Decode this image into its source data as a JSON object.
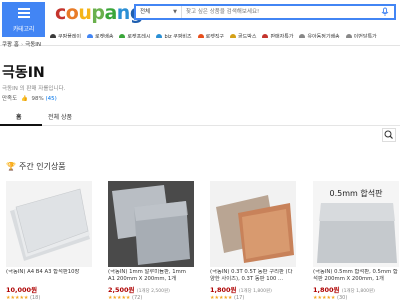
{
  "colors": {
    "accent": "#4285f4",
    "price": "#ae0000",
    "star": "#f5a623"
  },
  "header": {
    "category_label": "카테고리",
    "logo_letters": [
      {
        "ch": "c",
        "color": "#c4342d"
      },
      {
        "ch": "o",
        "color": "#e87b27"
      },
      {
        "ch": "u",
        "color": "#f5b519"
      },
      {
        "ch": "p",
        "color": "#6ab04c"
      },
      {
        "ch": "a",
        "color": "#3aa63a"
      },
      {
        "ch": "n",
        "color": "#2a8fd4"
      },
      {
        "ch": "g",
        "color": "#1f5fb0"
      }
    ],
    "search_scope": "전체",
    "search_placeholder": "찾고 싶은 상품을 검색해보세요!",
    "quick_links": [
      {
        "label": "쿠팡플레이",
        "color": "#3a3a3a"
      },
      {
        "label": "로켓배송",
        "color": "#4285f4"
      },
      {
        "label": "로켓프레시",
        "color": "#3aa63a"
      },
      {
        "label": "biz 쿠팡비즈",
        "color": "#2a8fd4"
      },
      {
        "label": "로켓직구",
        "color": "#e84e1b"
      },
      {
        "label": "골드박스",
        "color": "#d4a017"
      },
      {
        "label": "판매자특가",
        "color": "#c4342d"
      },
      {
        "label": "유아동정기배송",
        "color": "#888888"
      },
      {
        "label": "이번달특가",
        "color": "#888888"
      }
    ]
  },
  "breadcrumb": [
    "쿠팡 홈",
    "극동IN"
  ],
  "store": {
    "title": "극동IN",
    "description": "극동IN 의 판매 자를입니다.",
    "rating_label": "만족도",
    "rating_value": "98%",
    "rating_count": "(45)"
  },
  "tabs": [
    {
      "label": "홈",
      "active": true
    },
    {
      "label": "전체 상품",
      "active": false
    }
  ],
  "section_title": "주간 인기상품",
  "products": [
    {
      "name": "(극동IN) A4 B4 A3 합석판10장",
      "price": "10,000원",
      "unit": "",
      "stars": "★★★★★",
      "reviews": "(18)",
      "img": "plate"
    },
    {
      "name": "(극동IN) 1mm 알루미늄판, 1mm A1 200mm X 200mm, 1개",
      "price": "2,500원",
      "unit": "(1개당 2,500원)",
      "stars": "★★★★★",
      "reviews": "(72)",
      "img": "alu"
    },
    {
      "name": "(극동IN) 0.3T 0.5T 동판 구리판 (다양한 사이즈), 0.3T 동판 100 ...",
      "price": "1,800원",
      "unit": "(1개당 1,800원)",
      "stars": "★★★★★",
      "reviews": "(17)",
      "img": "copper"
    },
    {
      "name": "(극동IN) 0.5mm 합석판, 0.5mm 합석판 200mm X 200mm, 1개",
      "price": "1,800원",
      "unit": "(1개당 1,800원)",
      "stars": "★★★★★",
      "reviews": "(30)",
      "img": "zinc",
      "img_caption": "0.5mm 합석판"
    }
  ]
}
